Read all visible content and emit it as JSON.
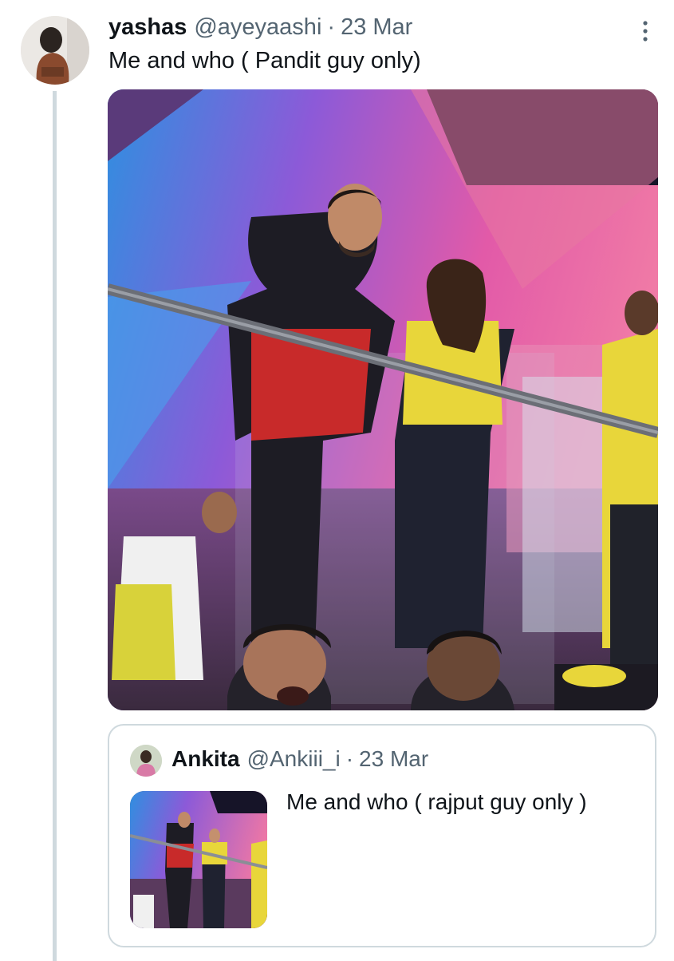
{
  "tweet": {
    "author_name": "yashas",
    "author_handle": "@ayeyaashi",
    "separator": "·",
    "date": "23 Mar",
    "text": "Me and who ( Pandit guy only)",
    "more_icon": "more-vertical-icon"
  },
  "quoted_tweet": {
    "author_name": "Ankita",
    "author_handle": "@Ankiii_i",
    "separator": "·",
    "date": "23 Mar",
    "text": "Me and who ( rajput guy only )"
  },
  "colors": {
    "text_primary": "#0f1419",
    "text_secondary": "#536471",
    "border": "#cfd9de"
  }
}
